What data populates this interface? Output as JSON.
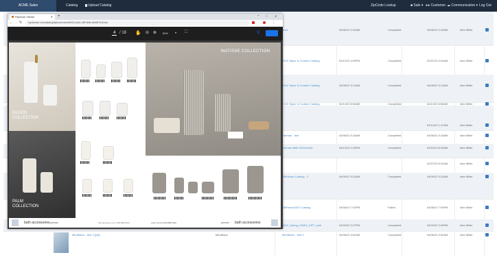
{
  "topnav": {
    "brand": "ACME Sales",
    "links": [
      "Catalog",
      "Upload Catalog"
    ],
    "zip_lookup": "ZipCode Lookup",
    "right_items": [
      "Sale",
      "Customer",
      "Communication",
      "Log Out"
    ]
  },
  "table_rows": [
    {
      "name": "test2",
      "date": "04/06/22 2:39AM",
      "status": "Completed",
      "completed": "04/06/22 2:39AM",
      "user": "Alex Miller"
    },
    {
      "name": "2019 Taylor & Couture Catalog",
      "date": "04/12/22 4:09PM",
      "status": "Completed",
      "completed": "02/21/23 4:04AM",
      "user": "Alex Miller"
    },
    {
      "name": "2019 Taylor & Couture Catalog",
      "date": "04/06/22 3:11AM",
      "status": "Completed",
      "completed": "04/06/22 3:11AM",
      "user": "Alex Miller"
    },
    {
      "name": "2019 Taylor & Couture Catalog",
      "date": "04/14/22 6:56AM",
      "status": "Completed",
      "completed": "04/14/22 6:56AM",
      "user": "Alex Miller"
    },
    {
      "name": "",
      "date": "",
      "status": "",
      "completed": "04/14/22 1:47AM",
      "user": "Alex Miller"
    },
    {
      "name": "Harman - test",
      "date": "04/06/22 3:16AM",
      "status": "Completed",
      "completed": "04/06/22 3:16AM",
      "user": "Alex Miller"
    },
    {
      "name": "Harman Bath 2022at test",
      "date": "04/12/22 2:28PM",
      "status": "Completed",
      "completed": "03/24/23 8:26AM",
      "user": "Alex Miller"
    },
    {
      "name": "",
      "date": "",
      "status": "",
      "completed": "02/27/23 9:20AM",
      "user": "Alex Miller"
    },
    {
      "name": "SMHouse Catalog - 2",
      "date": "04/09/22 4:24AM",
      "status": "Completed",
      "completed": "04/09/22 4:24AM",
      "user": "Alex Miller"
    },
    {
      "name": "SMHouse2022 Catalog",
      "date": "04/08/22 7:02PM",
      "status": "Failed",
      "completed": "04/08/22 7:00PM",
      "user": "Alex Miller"
    },
    {
      "name": "2022_Spring_CARD_GIFT_web",
      "date": "04/09/22 2:37PM",
      "status": "Completed",
      "completed": "04/09/22 2:59PM",
      "user": "Alex Miller"
    },
    {
      "name": "MindMaxx - test 2",
      "date": "04/06/22 4:52AM",
      "status": "Completed",
      "completed": "04/06/22 4:52AM",
      "user": "Alex Miller",
      "file": "MindMaxx - test 2 [pdf]",
      "company": "MindMaxx"
    }
  ],
  "viewer": {
    "tab_title": "Flipbook Viewer",
    "url": "mydomain.com/catalog/flipbook/view/b8424-a9c4-49ff-9e8c-8e68f7d1b2aa",
    "page_current": "4",
    "page_total": "/ 18",
    "zoom": "85%",
    "left_page": {
      "collection_1": "EILEEN COLLECTION",
      "collection_2": "PALM COLLECTION",
      "footer_brand": "bath accessories",
      "footer_label": "premier",
      "footer_contact": "harmanhouse.com  |  866.888.5020"
    },
    "right_page": {
      "collection": "MATISSE COLLECTION",
      "footer_order": "order toll free 866.888.5020",
      "footer_label": "premier",
      "footer_brand": "bath accessories"
    }
  },
  "colors": {
    "nav_bg": "#1f2c3d",
    "brand_bg": "#2f4b6e",
    "link": "#4a8cc7",
    "viewer_toolbar": "#1e1e1e",
    "accent_blue": "#1a73e8"
  }
}
